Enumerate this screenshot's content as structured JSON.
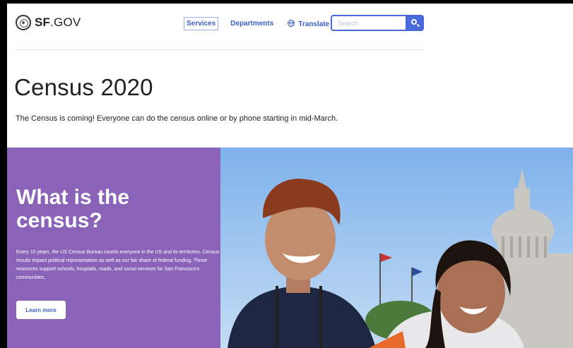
{
  "header": {
    "logo_bold": "SF",
    "logo_rest": ".GOV",
    "nav": {
      "services": "Services",
      "departments": "Departments",
      "translate": "Translate"
    },
    "search": {
      "placeholder": "Search"
    }
  },
  "main": {
    "title": "Census 2020",
    "subtitle": "The Census is coming! Everyone can do the census online or by phone starting in mid-March."
  },
  "hero": {
    "heading": "What is the census?",
    "body": "Every 10 years, the US Census Bureau counts everyone in the US and its territories. Census results impact political representation as well as our fair share of federal funding. Those resources support schools, hospitals, roads, and social services for San Francisco's communities.",
    "button": "Learn more",
    "colors": {
      "panel": "#8a63b8",
      "link": "#3b5fc7",
      "search": "#4a6ad9"
    }
  }
}
